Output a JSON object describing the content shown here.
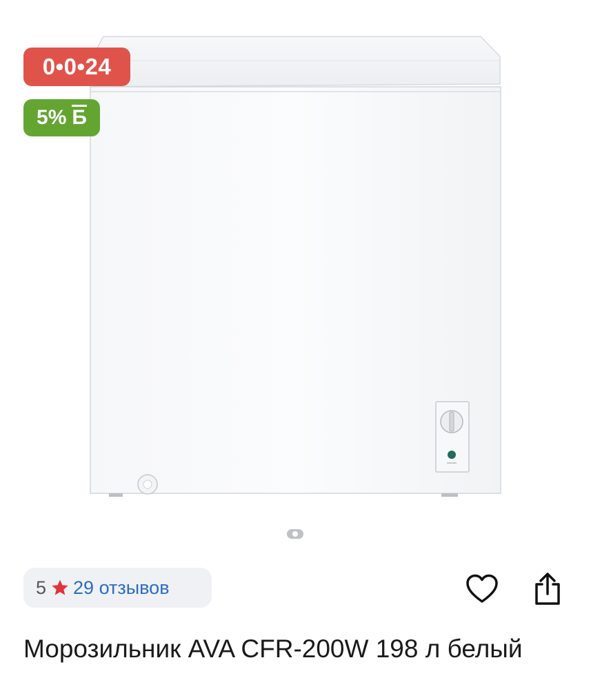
{
  "badges": {
    "countdown": "0•0•24",
    "cashback_percent": "5%",
    "cashback_symbol": "Б"
  },
  "gallery": {
    "image_icon": "chest-freezer-photo",
    "current_page": 1,
    "page_count": 1
  },
  "rating": {
    "score": "5",
    "reviews": "29 отзывов",
    "star_color": "#e0343a"
  },
  "actions": {
    "favorite_icon": "heart-outline-icon",
    "share_icon": "share-icon"
  },
  "product": {
    "title": "Морозильник AVA CFR-200W 198 л белый"
  },
  "colors": {
    "countdown_badge": "#e0534a",
    "cashback_badge": "#64a532",
    "link": "#2a6cc4",
    "pill_bg": "#f0f1f4"
  }
}
